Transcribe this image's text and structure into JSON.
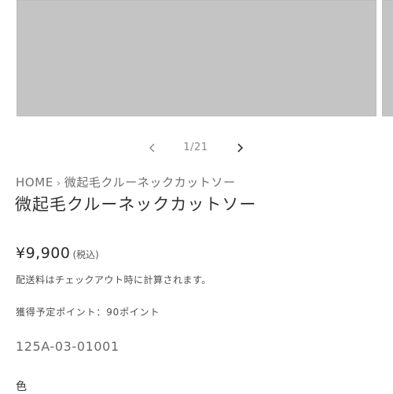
{
  "gallery": {
    "counter": "1/21"
  },
  "icons": {
    "prev": "chevron-left-icon",
    "next": "chevron-right-icon"
  },
  "breadcrumb": {
    "home": "HOME",
    "separator": "›",
    "current": "微起毛クルーネックカットソー"
  },
  "product": {
    "title": "微起毛クルーネックカットソー",
    "price": "¥9,900",
    "tax_note": "(税込)",
    "shipping_note": "配送料はチェックアウト時に計算されます。",
    "points_note": "獲得予定ポイント：90ポイント",
    "sku": "125A-03-01001",
    "color_label": "色"
  },
  "colors": {
    "image_placeholder": "#c4c4c4",
    "text_primary": "#333333",
    "text_muted": "#8a8a8a"
  }
}
